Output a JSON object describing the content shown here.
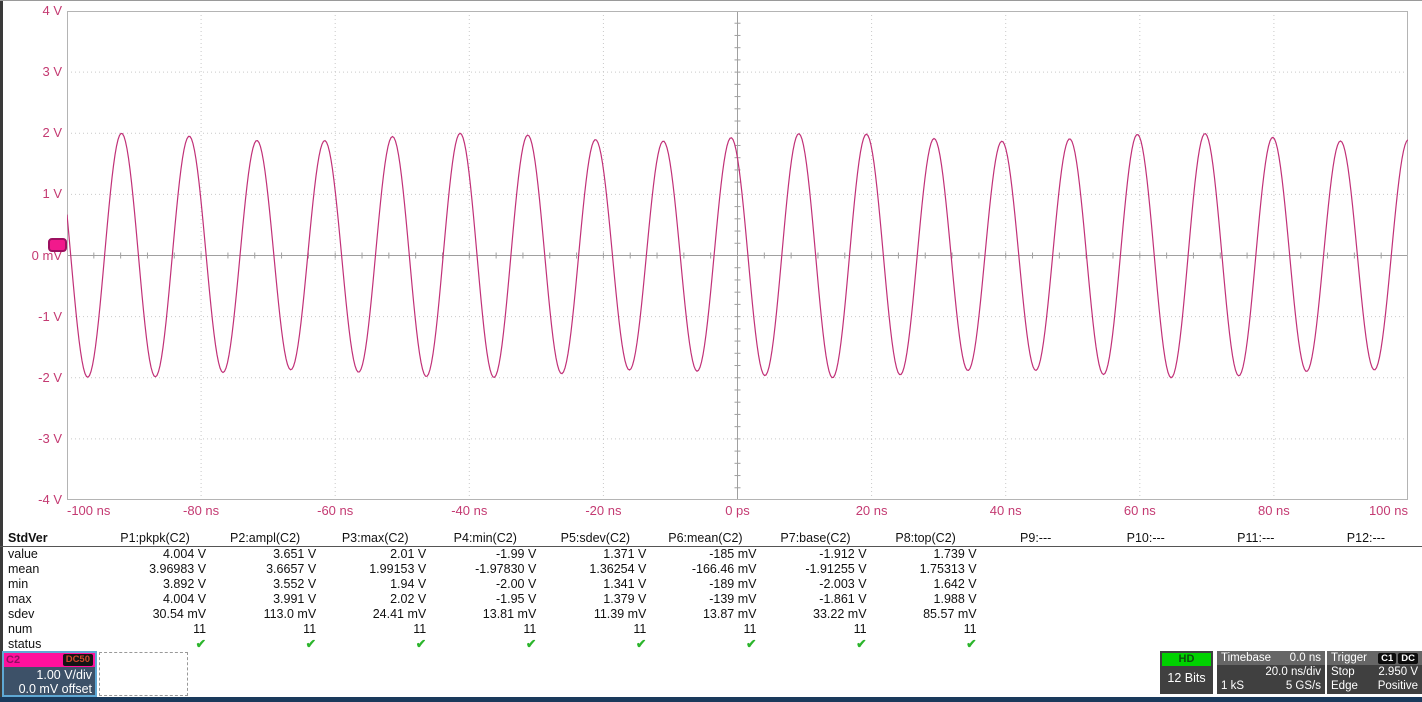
{
  "colors": {
    "trace": "#c13178",
    "axis_text": "#c43a72",
    "grid_line": "#c9c9c9",
    "grid_center": "#a0a0a0",
    "grid_border": "#b4b4b4",
    "check_green": "#2cb52c",
    "channel_header": "#ff109c",
    "channel_name_text": "#8e0f63",
    "channel_body": "#3d5168",
    "dc50_text": "#d0492c",
    "hd_green": "#00d200",
    "hd_text": "#0b4d0b",
    "box_dark": "#404040",
    "box_header": "#666666",
    "bottom_strip": "#1a3a5c",
    "marker_fill": "#f2198c",
    "marker_border": "#9c1060"
  },
  "chart_data": {
    "type": "line",
    "title": "Channel C2 sine waveform",
    "x_unit": "ns",
    "x_range": [
      -100,
      100
    ],
    "y_unit": "V",
    "y_range": [
      -4,
      4
    ],
    "time_per_div": "20.0 ns/div",
    "volts_per_div": "1.00 V/div",
    "divisions_x": 10,
    "divisions_y": 8,
    "x_tick_labels": [
      "-100 ns",
      "-80 ns",
      "-60 ns",
      "-40 ns",
      "-20 ns",
      "0 ps",
      "20 ns",
      "40 ns",
      "60 ns",
      "80 ns",
      "100 ns"
    ],
    "y_tick_labels": [
      "4 V",
      "3 V",
      "2 V",
      "1 V",
      "0 mV",
      "-1 V",
      "-2 V",
      "-3 V",
      "-4 V"
    ],
    "grid": true,
    "waveform": {
      "shape": "sine",
      "amplitude_v": 1.935,
      "amplitude_mod_v": 0.065,
      "amplitude_mod_period_ns": 53,
      "period_ns": 10.1,
      "peak_at_ns": -0.97,
      "offset_v": 0.0
    }
  },
  "measure": {
    "corner_label": "StdVer",
    "row_labels": [
      "value",
      "mean",
      "min",
      "max",
      "sdev",
      "num",
      "status"
    ],
    "check_glyph": "✔",
    "columns": [
      {
        "header": "P1:pkpk(C2)",
        "value": "4.004 V",
        "mean": "3.96983 V",
        "min": "3.892 V",
        "max": "4.004 V",
        "sdev": "30.54 mV",
        "num": "11",
        "status": "ok"
      },
      {
        "header": "P2:ampl(C2)",
        "value": "3.651 V",
        "mean": "3.6657 V",
        "min": "3.552 V",
        "max": "3.991 V",
        "sdev": "113.0 mV",
        "num": "11",
        "status": "ok"
      },
      {
        "header": "P3:max(C2)",
        "value": "2.01 V",
        "mean": "1.99153 V",
        "min": "1.94 V",
        "max": "2.02 V",
        "sdev": "24.41 mV",
        "num": "11",
        "status": "ok"
      },
      {
        "header": "P4:min(C2)",
        "value": "-1.99 V",
        "mean": "-1.97830 V",
        "min": "-2.00 V",
        "max": "-1.95 V",
        "sdev": "13.81 mV",
        "num": "11",
        "status": "ok"
      },
      {
        "header": "P5:sdev(C2)",
        "value": "1.371 V",
        "mean": "1.36254 V",
        "min": "1.341 V",
        "max": "1.379 V",
        "sdev": "11.39 mV",
        "num": "11",
        "status": "ok"
      },
      {
        "header": "P6:mean(C2)",
        "value": "-185 mV",
        "mean": "-166.46 mV",
        "min": "-189 mV",
        "max": "-139 mV",
        "sdev": "13.87 mV",
        "num": "11",
        "status": "ok"
      },
      {
        "header": "P7:base(C2)",
        "value": "-1.912 V",
        "mean": "-1.91255 V",
        "min": "-2.003 V",
        "max": "-1.861 V",
        "sdev": "33.22 mV",
        "num": "11",
        "status": "ok"
      },
      {
        "header": "P8:top(C2)",
        "value": "1.739 V",
        "mean": "1.75313 V",
        "min": "1.642 V",
        "max": "1.988 V",
        "sdev": "85.57 mV",
        "num": "11",
        "status": "ok"
      },
      {
        "header": "P9:---",
        "value": "",
        "mean": "",
        "min": "",
        "max": "",
        "sdev": "",
        "num": "",
        "status": ""
      },
      {
        "header": "P10:---",
        "value": "",
        "mean": "",
        "min": "",
        "max": "",
        "sdev": "",
        "num": "",
        "status": ""
      },
      {
        "header": "P11:---",
        "value": "",
        "mean": "",
        "min": "",
        "max": "",
        "sdev": "",
        "num": "",
        "status": ""
      },
      {
        "header": "P12:---",
        "value": "",
        "mean": "",
        "min": "",
        "max": "",
        "sdev": "",
        "num": "",
        "status": ""
      }
    ]
  },
  "channel": {
    "name": "C2",
    "coupling": "DC50",
    "scale": "1.00 V/div",
    "offset": "0.0 mV offset"
  },
  "acquisition": {
    "hd_label": "HD",
    "bits": "12 Bits"
  },
  "timebase": {
    "label": "Timebase",
    "position": "0.0 ns",
    "scale": "20.0 ns/div",
    "samples": "1 kS",
    "rate": "5 GS/s"
  },
  "trigger": {
    "label": "Trigger",
    "source": "C1",
    "coupling": "DC",
    "mode": "Stop",
    "level": "2.950 V",
    "type": "Edge",
    "slope": "Positive"
  }
}
